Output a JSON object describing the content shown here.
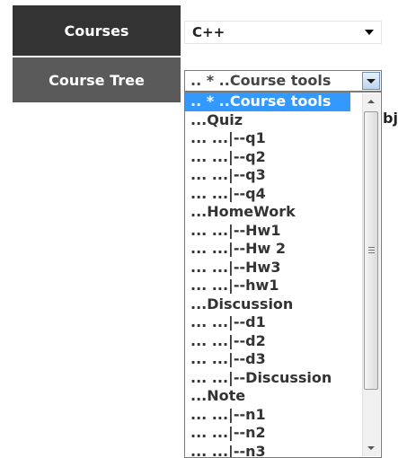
{
  "courses": {
    "label": "Courses",
    "selected": "C++"
  },
  "course_tree": {
    "label": "Course Tree",
    "selected": ".. * ..Course tools",
    "options": [
      ".. * ..Course tools",
      "...Quiz",
      "... ...|--q1",
      "... ...|--q2",
      "... ...|--q3",
      "... ...|--q4",
      "...HomeWork",
      "... ...|--Hw1",
      "... ...|--Hw 2",
      "... ...|--Hw3",
      "... ...|--hw1",
      "...Discussion",
      "... ...|--d1",
      "... ...|--d2",
      "... ...|--d3",
      "... ...|--Discussion",
      "...Note",
      "... ...|--n1",
      "... ...|--n2",
      "... ...|--n3"
    ]
  },
  "background_text": "bj"
}
